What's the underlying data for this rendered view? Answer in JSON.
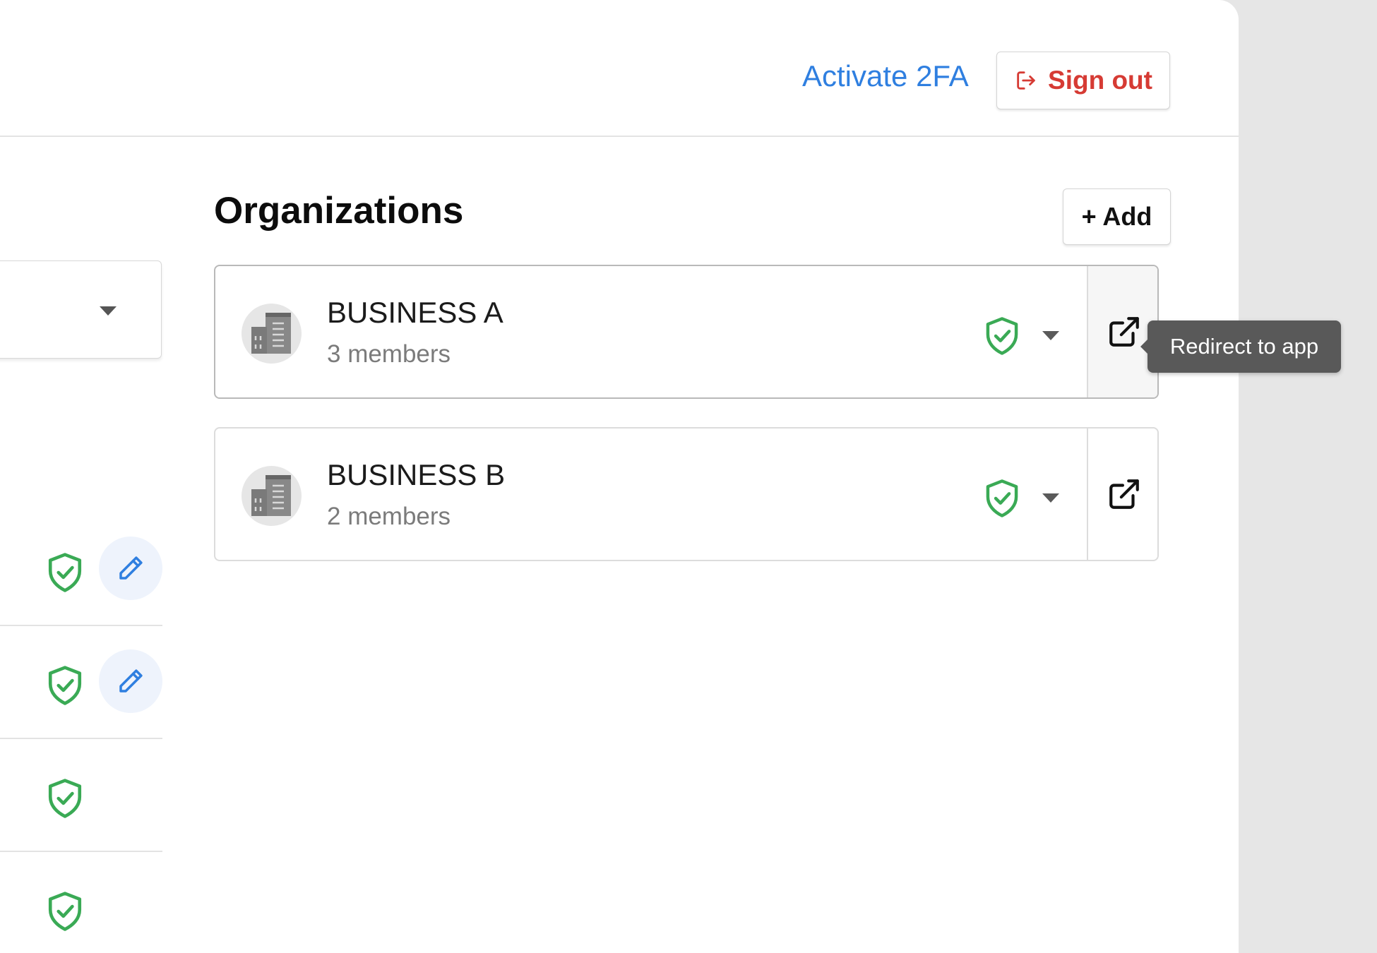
{
  "header": {
    "activate_2fa": "Activate 2FA",
    "sign_out": "Sign out"
  },
  "organizations": {
    "title": "Organizations",
    "add_label": "+ Add",
    "items": [
      {
        "name": "BUSINESS A",
        "members": "3 members"
      },
      {
        "name": "BUSINESS B",
        "members": "2 members"
      }
    ]
  },
  "tooltip": {
    "text": "Redirect to app"
  },
  "icons": {
    "sign_out": "sign-out-icon",
    "shield": "shield-check-icon",
    "edit": "pencil-icon",
    "building": "building-icon",
    "redirect": "external-link-icon",
    "caret": "caret-down-icon"
  },
  "colors": {
    "link": "#2f7fe0",
    "sign_out": "#d63b34",
    "shield": "#3aaa55",
    "edit": "#2f7fe0",
    "tooltip_bg": "#595959"
  }
}
